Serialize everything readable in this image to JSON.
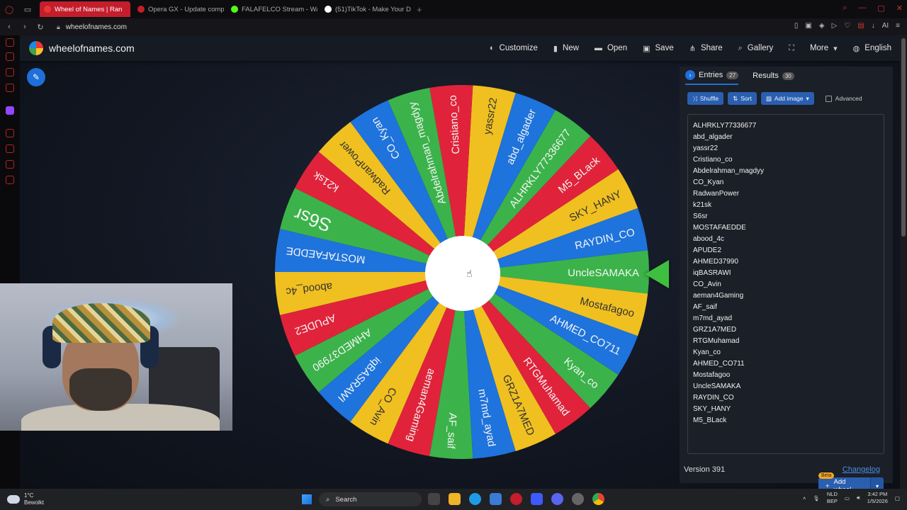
{
  "browser": {
    "tabs": [
      {
        "label": "Wheel of Names | Ran",
        "active": true,
        "color": "#e53935"
      },
      {
        "label": "Opera GX - Update compl",
        "active": false,
        "color": "#c41d2c"
      },
      {
        "label": "FALAFELCO Stream - Wat",
        "active": false,
        "color": "#53fc18"
      },
      {
        "label": "(51)TikTok - Make Your Da",
        "active": false,
        "color": "#ffffff"
      }
    ],
    "url": "wheelofnames.com"
  },
  "site": {
    "title": "wheelofnames.com",
    "menu": [
      {
        "label": "Customize",
        "icon": "palette-icon",
        "glyph": "◐"
      },
      {
        "label": "New",
        "icon": "file-icon",
        "glyph": "▮"
      },
      {
        "label": "Open",
        "icon": "folder-icon",
        "glyph": "▬"
      },
      {
        "label": "Save",
        "icon": "save-icon",
        "glyph": "▣"
      },
      {
        "label": "Share",
        "icon": "share-icon",
        "glyph": "⋔"
      },
      {
        "label": "Gallery",
        "icon": "search-icon",
        "glyph": "⌕"
      },
      {
        "label": "",
        "icon": "fullscreen-icon",
        "glyph": "⛶"
      },
      {
        "label": "More",
        "icon": "chevron-down-icon",
        "glyph": "▾"
      },
      {
        "label": "English",
        "icon": "globe-icon",
        "glyph": "◍"
      }
    ]
  },
  "wheel": {
    "colors": [
      "#3bb34a",
      "#1e73dc",
      "#f0c020",
      "#e0233a"
    ],
    "segments": [
      "UncleSAMAKA",
      "RAYDIN_CO",
      "SKY_HANY",
      "M5_BLack",
      "ALHRKLY77336677",
      "abd_algader",
      "yassr22",
      "Cristiano_co",
      "Abdelrahman_magdyy",
      "CO_Kyan",
      "RadwanPower",
      "k21sk",
      "S6sr",
      "MOSTAFAEDDE",
      "abood_4c",
      "APUDE2",
      "AHMED37990",
      "iqBASRAWI",
      "CO_Avin",
      "aeman4Gaming",
      "AF_saif",
      "m7md_ayad",
      "GRZ1A7MED",
      "RTGMuhamad",
      "Kyan_co",
      "AHMED_CO711",
      "Mostafagoo"
    ]
  },
  "panel": {
    "entries_tab": "Entries",
    "entries_count": "27",
    "results_tab": "Results",
    "results_count": "30",
    "shuffle": "Shuffle",
    "sort": "Sort",
    "add_image": "Add image",
    "advanced": "Advanced",
    "entries": [
      "ALHRKLY77336677",
      "abd_algader",
      "yassr22",
      "Cristiano_co",
      "Abdelrahman_magdyy",
      "CO_Kyan",
      "RadwanPower",
      "k21sk",
      "S6sr",
      "MOSTAFAEDDE",
      "abood_4c",
      "APUDE2",
      "AHMED37990",
      "iqBASRAWI",
      "CO_Avin",
      "aeman4Gaming",
      "AF_saif",
      "m7md_ayad",
      "GRZ1A7MED",
      "RTGMuhamad",
      "Kyan_co",
      "AHMED_CO711",
      "Mostafagoo",
      "UncleSAMAKA",
      "RAYDIN_CO",
      "SKY_HANY",
      "M5_BLack"
    ],
    "beta": "Beta",
    "add_wheel": "Add wheel",
    "version": "Version 391",
    "changelog": "Changelog"
  },
  "taskbar": {
    "temp": "1°C",
    "weather": "Bewolkt",
    "search": "Search",
    "lang1": "NLD",
    "lang2": "BEP",
    "time": "3:42 PM",
    "date": "1/5/2026"
  }
}
